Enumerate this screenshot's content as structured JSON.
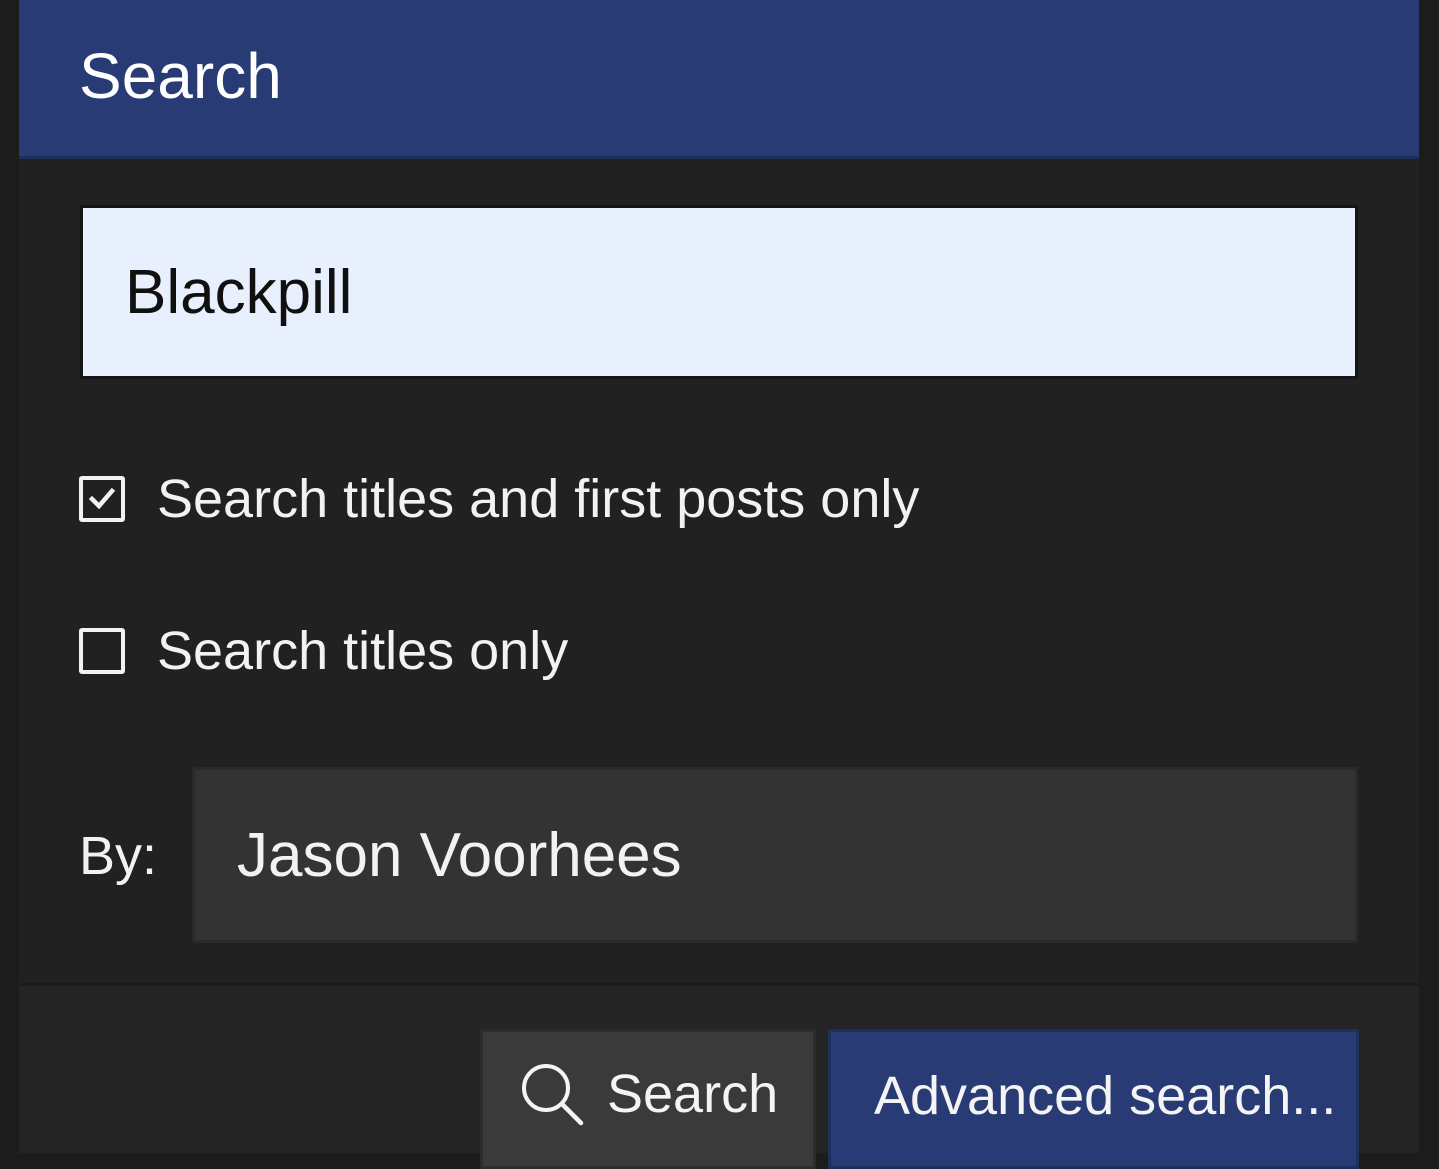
{
  "header": {
    "title": "Search"
  },
  "query": {
    "value": "Blackpill"
  },
  "options": [
    {
      "label": "Search titles and first posts only",
      "checked": true
    },
    {
      "label": "Search titles only",
      "checked": false
    }
  ],
  "by": {
    "label": "By:",
    "value": "Jason Voorhees"
  },
  "footer": {
    "search_label": "Search",
    "search_icon": "magnifier-icon",
    "advanced_label": "Advanced search..."
  },
  "colors": {
    "accent": "#283b74",
    "panel": "#212121",
    "input_light": "#e8effd",
    "input_dark": "#333333"
  }
}
